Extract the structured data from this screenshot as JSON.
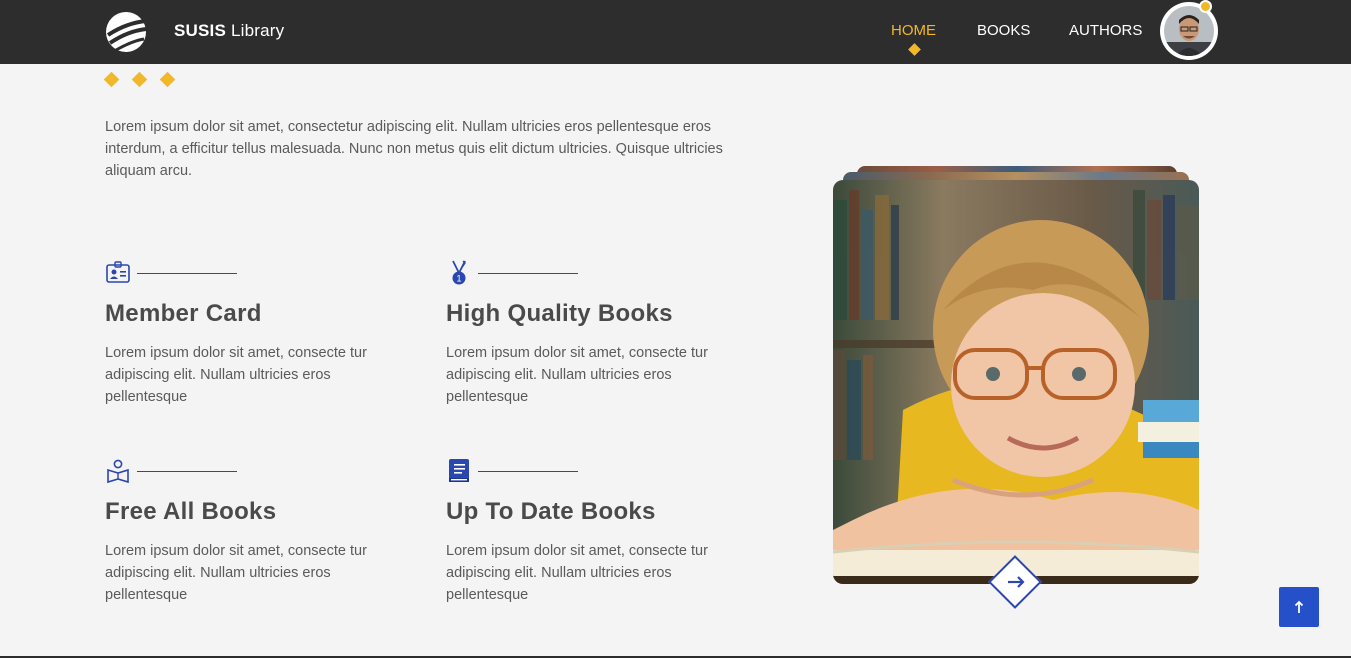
{
  "brand": {
    "name_bold": "SUSIS",
    "name_rest": "Library"
  },
  "nav": {
    "items": [
      {
        "label": "HOME",
        "active": true
      },
      {
        "label": "BOOKS",
        "active": false
      },
      {
        "label": "AUTHORS",
        "active": false
      }
    ]
  },
  "intro": {
    "text": "Lorem ipsum dolor sit amet, consectetur adipiscing elit. Nullam ultricies eros pellentesque eros interdum, a efficitur tellus malesuada. Nunc non metus quis elit dictum ultricies. Quisque ultricies aliquam arcu."
  },
  "features": [
    {
      "title": "Member Card",
      "text": "Lorem ipsum dolor sit amet, consecte tur adipiscing elit. Nullam ultricies eros pellentesque",
      "icon": "id-card-icon"
    },
    {
      "title": "High Quality Books",
      "text": "Lorem ipsum dolor sit amet, consecte tur adipiscing elit. Nullam ultricies eros pellentesque",
      "icon": "medal-icon"
    },
    {
      "title": "Free All Books",
      "text": "Lorem ipsum dolor sit amet, consecte tur adipiscing elit. Nullam ultricies eros pellentesque",
      "icon": "reader-icon"
    },
    {
      "title": "Up To Date Books",
      "text": "Lorem ipsum dolor sit amet, consecte tur adipiscing elit. Nullam ultricies eros pellentesque",
      "icon": "book-icon"
    }
  ],
  "colors": {
    "header_bg": "#2d2d2d",
    "accent": "#f2b827",
    "primary": "#2a47b0",
    "page_bg": "#f4f4f5"
  }
}
